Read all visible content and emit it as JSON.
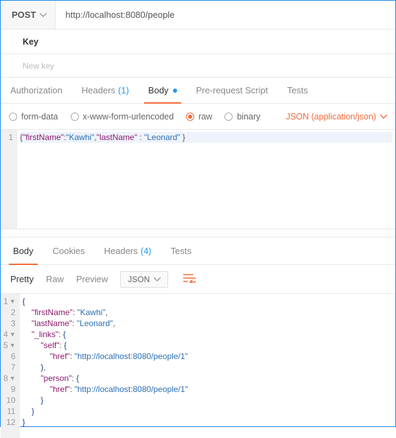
{
  "method": "POST",
  "url": "http://localhost:8080/people",
  "key_header": "Key",
  "new_key_placeholder": "New key",
  "req_tabs": {
    "auth": "Authorization",
    "headers": "Headers",
    "headers_count": "(1)",
    "body": "Body",
    "prereq": "Pre-request Script",
    "tests": "Tests"
  },
  "body_types": {
    "formdata": "form-data",
    "urlencoded": "x-www-form-urlencoded",
    "raw": "raw",
    "binary": "binary"
  },
  "content_type": "JSON (application/json)",
  "request_body": {
    "raw": "{\"firstName\":\"Kawhi\",\"lastName\" : \"Leonard\" }",
    "tokens": [
      {
        "t": "p",
        "v": "{"
      },
      {
        "t": "k",
        "v": "\"firstName\""
      },
      {
        "t": "p",
        "v": ":"
      },
      {
        "t": "s",
        "v": "\"Kawhi\""
      },
      {
        "t": "p",
        "v": ","
      },
      {
        "t": "k",
        "v": "\"lastName\""
      },
      {
        "t": "p",
        "v": " : "
      },
      {
        "t": "s",
        "v": "\"Leonard\""
      },
      {
        "t": "p",
        "v": " }"
      }
    ]
  },
  "resp_tabs": {
    "body": "Body",
    "cookies": "Cookies",
    "headers": "Headers",
    "headers_count": "(4)",
    "tests": "Tests"
  },
  "view_modes": {
    "pretty": "Pretty",
    "raw": "Raw",
    "preview": "Preview"
  },
  "resp_lang": "JSON",
  "response_body": {
    "object": {
      "firstName": "Kawhi",
      "lastName": "Leonard",
      "_links": {
        "self": {
          "href": "http://localhost:8080/people/1"
        },
        "person": {
          "href": "http://localhost:8080/people/1"
        }
      }
    },
    "lines": [
      {
        "n": 1,
        "fold": true,
        "indent": 0,
        "toks": [
          {
            "t": "b",
            "v": "{"
          }
        ]
      },
      {
        "n": 2,
        "indent": 1,
        "toks": [
          {
            "t": "k",
            "v": "\"firstName\""
          },
          {
            "t": "p",
            "v": ": "
          },
          {
            "t": "s",
            "v": "\"Kawhi\""
          },
          {
            "t": "p",
            "v": ","
          }
        ]
      },
      {
        "n": 3,
        "indent": 1,
        "toks": [
          {
            "t": "k",
            "v": "\"lastName\""
          },
          {
            "t": "p",
            "v": ": "
          },
          {
            "t": "s",
            "v": "\"Leonard\""
          },
          {
            "t": "p",
            "v": ","
          }
        ]
      },
      {
        "n": 4,
        "fold": true,
        "indent": 1,
        "toks": [
          {
            "t": "k",
            "v": "\"_links\""
          },
          {
            "t": "p",
            "v": ": "
          },
          {
            "t": "b",
            "v": "{"
          }
        ]
      },
      {
        "n": 5,
        "fold": true,
        "indent": 2,
        "toks": [
          {
            "t": "k",
            "v": "\"self\""
          },
          {
            "t": "p",
            "v": ": "
          },
          {
            "t": "b",
            "v": "{"
          }
        ]
      },
      {
        "n": 6,
        "indent": 3,
        "toks": [
          {
            "t": "k",
            "v": "\"href\""
          },
          {
            "t": "p",
            "v": ": "
          },
          {
            "t": "s",
            "v": "\"http://localhost:8080/people/1\""
          }
        ]
      },
      {
        "n": 7,
        "indent": 2,
        "toks": [
          {
            "t": "b",
            "v": "}"
          },
          {
            "t": "p",
            "v": ","
          }
        ]
      },
      {
        "n": 8,
        "fold": true,
        "indent": 2,
        "toks": [
          {
            "t": "k",
            "v": "\"person\""
          },
          {
            "t": "p",
            "v": ": "
          },
          {
            "t": "b",
            "v": "{"
          }
        ]
      },
      {
        "n": 9,
        "indent": 3,
        "toks": [
          {
            "t": "k",
            "v": "\"href\""
          },
          {
            "t": "p",
            "v": ": "
          },
          {
            "t": "s",
            "v": "\"http://localhost:8080/people/1\""
          }
        ]
      },
      {
        "n": 10,
        "indent": 2,
        "toks": [
          {
            "t": "b",
            "v": "}"
          }
        ]
      },
      {
        "n": 11,
        "indent": 1,
        "toks": [
          {
            "t": "b",
            "v": "}"
          }
        ]
      },
      {
        "n": 12,
        "indent": 0,
        "toks": [
          {
            "t": "b",
            "v": "}"
          }
        ]
      }
    ]
  }
}
